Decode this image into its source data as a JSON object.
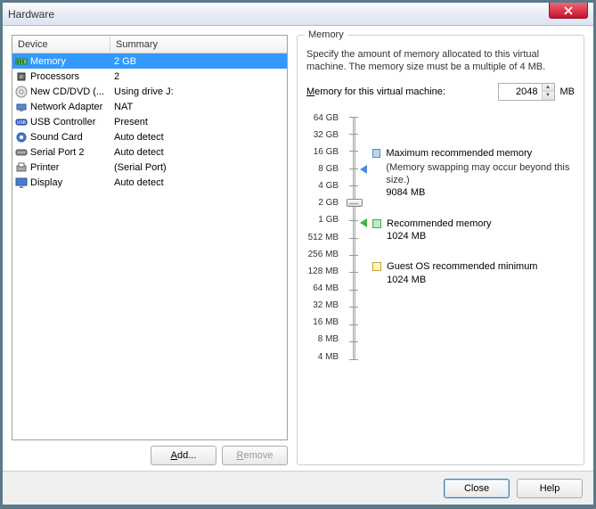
{
  "window": {
    "title": "Hardware"
  },
  "table": {
    "headers": {
      "device": "Device",
      "summary": "Summary"
    },
    "rows": [
      {
        "icon": "memory",
        "name": "Memory",
        "summary": "2 GB",
        "selected": true
      },
      {
        "icon": "cpu",
        "name": "Processors",
        "summary": "2"
      },
      {
        "icon": "cd",
        "name": "New CD/DVD (...",
        "summary": "Using drive J:"
      },
      {
        "icon": "net",
        "name": "Network Adapter",
        "summary": "NAT"
      },
      {
        "icon": "usb",
        "name": "USB Controller",
        "summary": "Present"
      },
      {
        "icon": "sound",
        "name": "Sound Card",
        "summary": "Auto detect"
      },
      {
        "icon": "serial",
        "name": "Serial Port 2",
        "summary": "Auto detect"
      },
      {
        "icon": "printer",
        "name": "Printer",
        "summary": "(Serial Port)"
      },
      {
        "icon": "display",
        "name": "Display",
        "summary": "Auto detect"
      }
    ]
  },
  "panel_buttons": {
    "add": "Add...",
    "remove": "Remove"
  },
  "memory": {
    "group_title": "Memory",
    "desc": "Specify the amount of memory allocated to this virtual machine. The memory size must be a multiple of 4 MB.",
    "label": "Memory for this virtual machine:",
    "value": "2048",
    "unit": "MB",
    "scale": [
      "64 GB",
      "32 GB",
      "16 GB",
      "8 GB",
      "4 GB",
      "2 GB",
      "1 GB",
      "512 MB",
      "256 MB",
      "128 MB",
      "64 MB",
      "32 MB",
      "16 MB",
      "8 MB",
      "4 MB"
    ],
    "legend": {
      "max": {
        "title": "Maximum recommended memory",
        "note": "(Memory swapping may occur beyond this size.)",
        "value": "9084 MB"
      },
      "rec": {
        "title": "Recommended memory",
        "value": "1024 MB"
      },
      "min": {
        "title": "Guest OS recommended minimum",
        "value": "1024 MB"
      }
    }
  },
  "footer": {
    "close": "Close",
    "help": "Help"
  },
  "chart_data": {
    "type": "bar",
    "orientation": "vertical-scale",
    "scale_ticks": [
      "64 GB",
      "32 GB",
      "16 GB",
      "8 GB",
      "4 GB",
      "2 GB",
      "1 GB",
      "512 MB",
      "256 MB",
      "128 MB",
      "64 MB",
      "32 MB",
      "16 MB",
      "8 MB",
      "4 MB"
    ],
    "current_value_mb": 2048,
    "markers": [
      {
        "name": "Maximum recommended memory",
        "value_mb": 9084,
        "color": "#4a8cd8"
      },
      {
        "name": "Recommended memory",
        "value_mb": 1024,
        "color": "#3cb04a"
      },
      {
        "name": "Guest OS recommended minimum",
        "value_mb": 1024,
        "color": "#caa830"
      }
    ]
  }
}
